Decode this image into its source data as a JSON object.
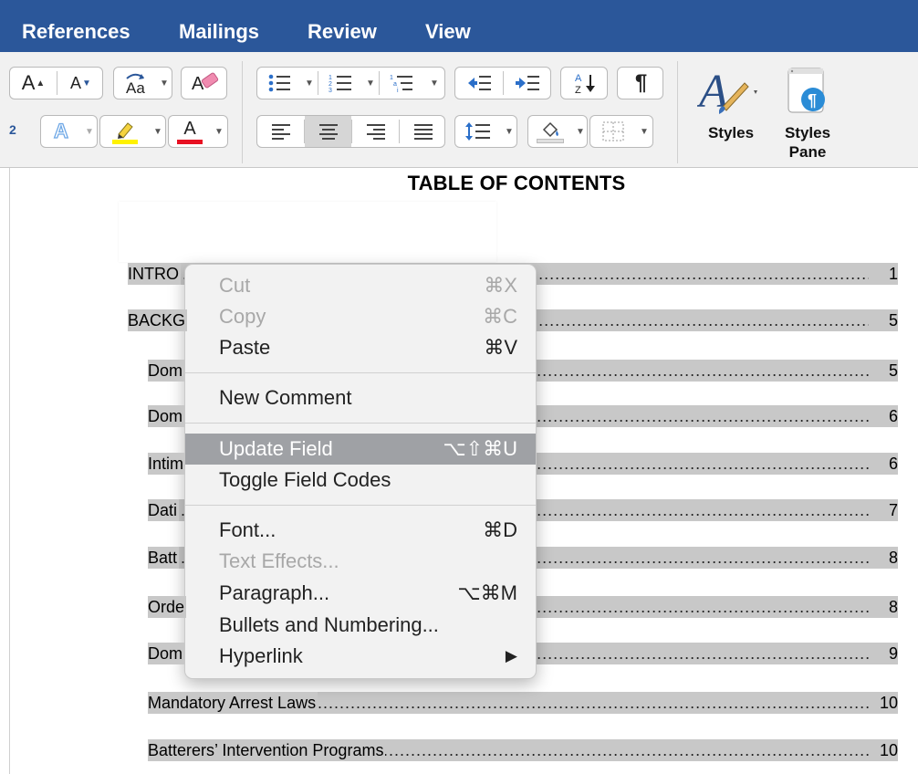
{
  "ribbon": {
    "tabs": [
      "References",
      "Mailings",
      "Review",
      "View"
    ],
    "styles_label": "Styles",
    "styles_pane_label": "Styles\nPane",
    "superscript_fragment": "2"
  },
  "document": {
    "title": "TABLE OF CONTENTS",
    "toc": [
      {
        "label": "INTRO",
        "page": "1"
      },
      {
        "label": "BACKG",
        "page": "5"
      },
      {
        "label": "Dom",
        "page": "5"
      },
      {
        "label": "Dom",
        "page": "6"
      },
      {
        "label": "Intim",
        "page": "6"
      },
      {
        "label": "Dati",
        "page": "7"
      },
      {
        "label": "Batt",
        "page": "8"
      },
      {
        "label": "Orde",
        "page": "8"
      },
      {
        "label": "Dom",
        "page": "9"
      },
      {
        "label": "Mandatory Arrest Laws",
        "page": "10"
      },
      {
        "label": "Batterers’ Intervention Programs",
        "page": "10"
      }
    ]
  },
  "context_menu": {
    "items": [
      {
        "label": "Cut",
        "shortcut": "⌘X",
        "disabled": true
      },
      {
        "label": "Copy",
        "shortcut": "⌘C",
        "disabled": true
      },
      {
        "label": "Paste",
        "shortcut": "⌘V"
      },
      {
        "label": "New Comment",
        "shortcut": ""
      },
      {
        "label": "Update Field",
        "shortcut": "⌥⇧⌘U",
        "highlighted": true
      },
      {
        "label": "Toggle Field Codes",
        "shortcut": ""
      },
      {
        "label": "Font...",
        "shortcut": "⌘D"
      },
      {
        "label": "Text Effects...",
        "shortcut": "",
        "disabled": true
      },
      {
        "label": "Paragraph...",
        "shortcut": "⌥⌘M"
      },
      {
        "label": "Bullets and Numbering...",
        "shortcut": ""
      },
      {
        "label": "Hyperlink",
        "shortcut": "▶"
      }
    ]
  },
  "colors": {
    "ribbon_tab_bg": "#2b579a",
    "highlight_yellow": "#fff200",
    "font_color_red": "#e81123",
    "menu_highlight": "#9fa1a5",
    "styles_pane_icon": "#2b8cd6"
  },
  "icons": {
    "grow_font": "grow-font-icon",
    "shrink_font": "shrink-font-icon",
    "change_case": "change-case-icon",
    "clear_formatting": "clear-formatting-icon",
    "bullets": "bullets-icon",
    "numbering": "numbering-icon",
    "multilevel": "multilevel-list-icon",
    "decrease_indent": "decrease-indent-icon",
    "increase_indent": "increase-indent-icon",
    "sort": "sort-icon",
    "show_formatting": "pilcrow-icon",
    "text_effects": "text-effects-icon",
    "highlight": "highlighter-icon",
    "font_color": "font-color-icon",
    "align_left": "align-left-icon",
    "align_center": "align-center-icon",
    "align_right": "align-right-icon",
    "justify": "justify-icon",
    "line_spacing": "line-spacing-icon",
    "shading": "shading-icon",
    "borders": "borders-icon",
    "styles": "styles-brush-icon",
    "styles_pane": "styles-pane-icon",
    "submenu_arrow": "submenu-arrow-icon"
  }
}
